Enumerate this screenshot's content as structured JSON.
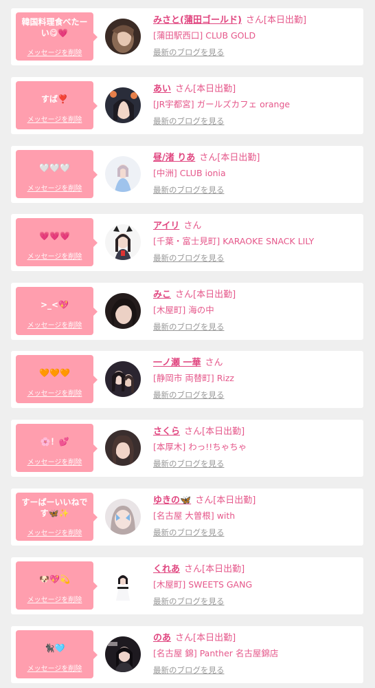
{
  "common": {
    "delete_label": "メッセージを削除",
    "blog_label": "最新のブログを見る"
  },
  "items": [
    {
      "message": "韓国料理食べたーい😋💗",
      "name": "みさと(蒲田ゴールド)",
      "san_status": "さん[本日出勤]",
      "shop": "[蒲田駅西口] CLUB GOLD"
    },
    {
      "message": "すば❣️",
      "name": "あい",
      "san_status": "さん[本日出勤]",
      "shop": "[JR宇都宮] ガールズカフェ orange"
    },
    {
      "message": "🤍🤍🤍",
      "name": "昼/渚 りあ",
      "san_status": "さん[本日出勤]",
      "shop": "[中洲] CLUB ionia"
    },
    {
      "message": "💗💗💗",
      "name": "アイリ",
      "san_status": "さん",
      "shop": "[千葉・富士見町] KARAOKE SNACK LILY"
    },
    {
      "message": ">_<💖",
      "name": "みこ",
      "san_status": "さん[本日出勤]",
      "shop": "[木屋町] 海の中"
    },
    {
      "message": "🧡🧡🧡",
      "name": "一ノ瀬 一華",
      "san_status": "さん",
      "shop": "[静岡市 両替町] Rizz"
    },
    {
      "message": "🌸！💕",
      "name": "さくら",
      "san_status": "さん[本日出勤]",
      "shop": "[本厚木] わっ!!ちゃちゃ"
    },
    {
      "message": "すーぱーいいねです🦋✨",
      "name": "ゆきの🦋",
      "san_status": "さん[本日出勤]",
      "shop": "[名古屋 大曽根] with"
    },
    {
      "message": "🐶💖💫",
      "name": "くれあ",
      "san_status": "さん[本日出勤]",
      "shop": "[木屋町] SWEETS GANG"
    },
    {
      "message": "🐈‍⬛🩵",
      "name": "のあ",
      "san_status": "さん[本日出勤]",
      "shop": "[名古屋 錦] Panther 名古屋錦店"
    }
  ]
}
